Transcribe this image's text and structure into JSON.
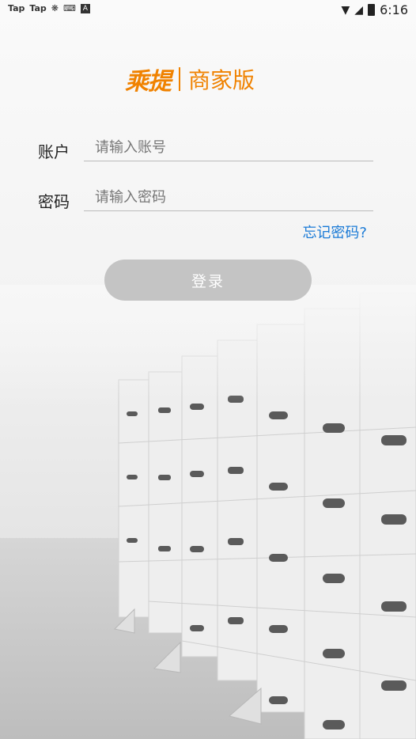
{
  "status_bar": {
    "left_items": [
      "Tap",
      "Tap"
    ],
    "time": "6:16"
  },
  "logo": {
    "brand": "乘提",
    "edition": "商家版"
  },
  "form": {
    "account_label": "账户",
    "account_placeholder": "请输入账号",
    "password_label": "密码",
    "password_placeholder": "请输入密码",
    "forgot_label": "忘记密码?",
    "login_label": "登录"
  },
  "colors": {
    "brand": "#f08200",
    "link": "#1a7ad6",
    "button_disabled": "#c4c4c4"
  }
}
